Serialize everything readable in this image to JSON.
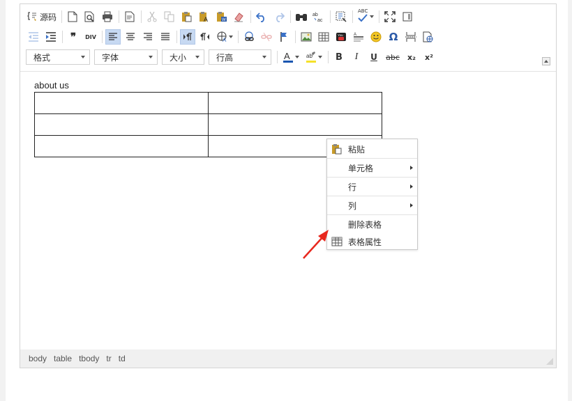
{
  "toolbar": {
    "source_label": "源码",
    "abc_label": "ABC",
    "format_label": "格式",
    "font_label": "字体",
    "size_label": "大小",
    "lineheight_label": "行高",
    "icons": {
      "row1": [
        "source-icon",
        "new-page-icon",
        "preview-icon",
        "print-icon",
        "templates-icon",
        "cut-icon",
        "copy-icon",
        "paste-icon",
        "paste-text-icon",
        "paste-word-icon",
        "remove-format-icon",
        "undo-icon",
        "redo-icon",
        "find-icon",
        "replace-icon",
        "select-all-icon",
        "spellcheck-icon",
        "maximize-icon",
        "show-blocks-icon"
      ],
      "row2": [
        "outdent-icon",
        "indent-icon",
        "blockquote-icon",
        "div-icon",
        "align-left-icon",
        "align-center-icon",
        "align-right-icon",
        "align-justify-icon",
        "ltr-icon",
        "rtl-icon",
        "language-icon",
        "link-icon",
        "unlink-icon",
        "anchor-icon",
        "image-icon",
        "table-icon",
        "youtube-icon",
        "horizontal-rule-icon",
        "smiley-icon",
        "special-char-icon",
        "page-break-icon",
        "iframe-icon"
      ],
      "row3": [
        "text-color-icon",
        "bg-color-icon",
        "bold-icon",
        "italic-icon",
        "underline-icon",
        "strike-icon",
        "subscript-icon",
        "superscript-icon"
      ]
    },
    "glyphs": {
      "blockquote": "❞",
      "div": "DIV",
      "omega": "Ω",
      "bold": "B",
      "italic": "I",
      "underline": "U",
      "strike": "abc",
      "sub": "x₂",
      "sup": "x²"
    },
    "colors": {
      "text_color_bar": "#1a56b0",
      "bg_color_bar": "#f5e12a",
      "accent": "#3a71c7"
    }
  },
  "content": {
    "paragraph": "about us",
    "table": {
      "rows": 3,
      "cols": 2
    }
  },
  "statusbar": {
    "crumbs": [
      "body",
      "table",
      "tbody",
      "tr",
      "td"
    ]
  },
  "context_menu": {
    "items": [
      {
        "label": "粘贴",
        "icon": "paste-icon",
        "submenu": false
      },
      {
        "label": "单元格",
        "icon": "",
        "submenu": true
      },
      {
        "label": "行",
        "icon": "",
        "submenu": true
      },
      {
        "label": "列",
        "icon": "",
        "submenu": true
      },
      {
        "label": "删除表格",
        "icon": "",
        "submenu": false
      },
      {
        "label": "表格属性",
        "icon": "table-properties-icon",
        "submenu": false
      }
    ]
  },
  "annotation": {
    "arrow_color": "#e8281e"
  }
}
